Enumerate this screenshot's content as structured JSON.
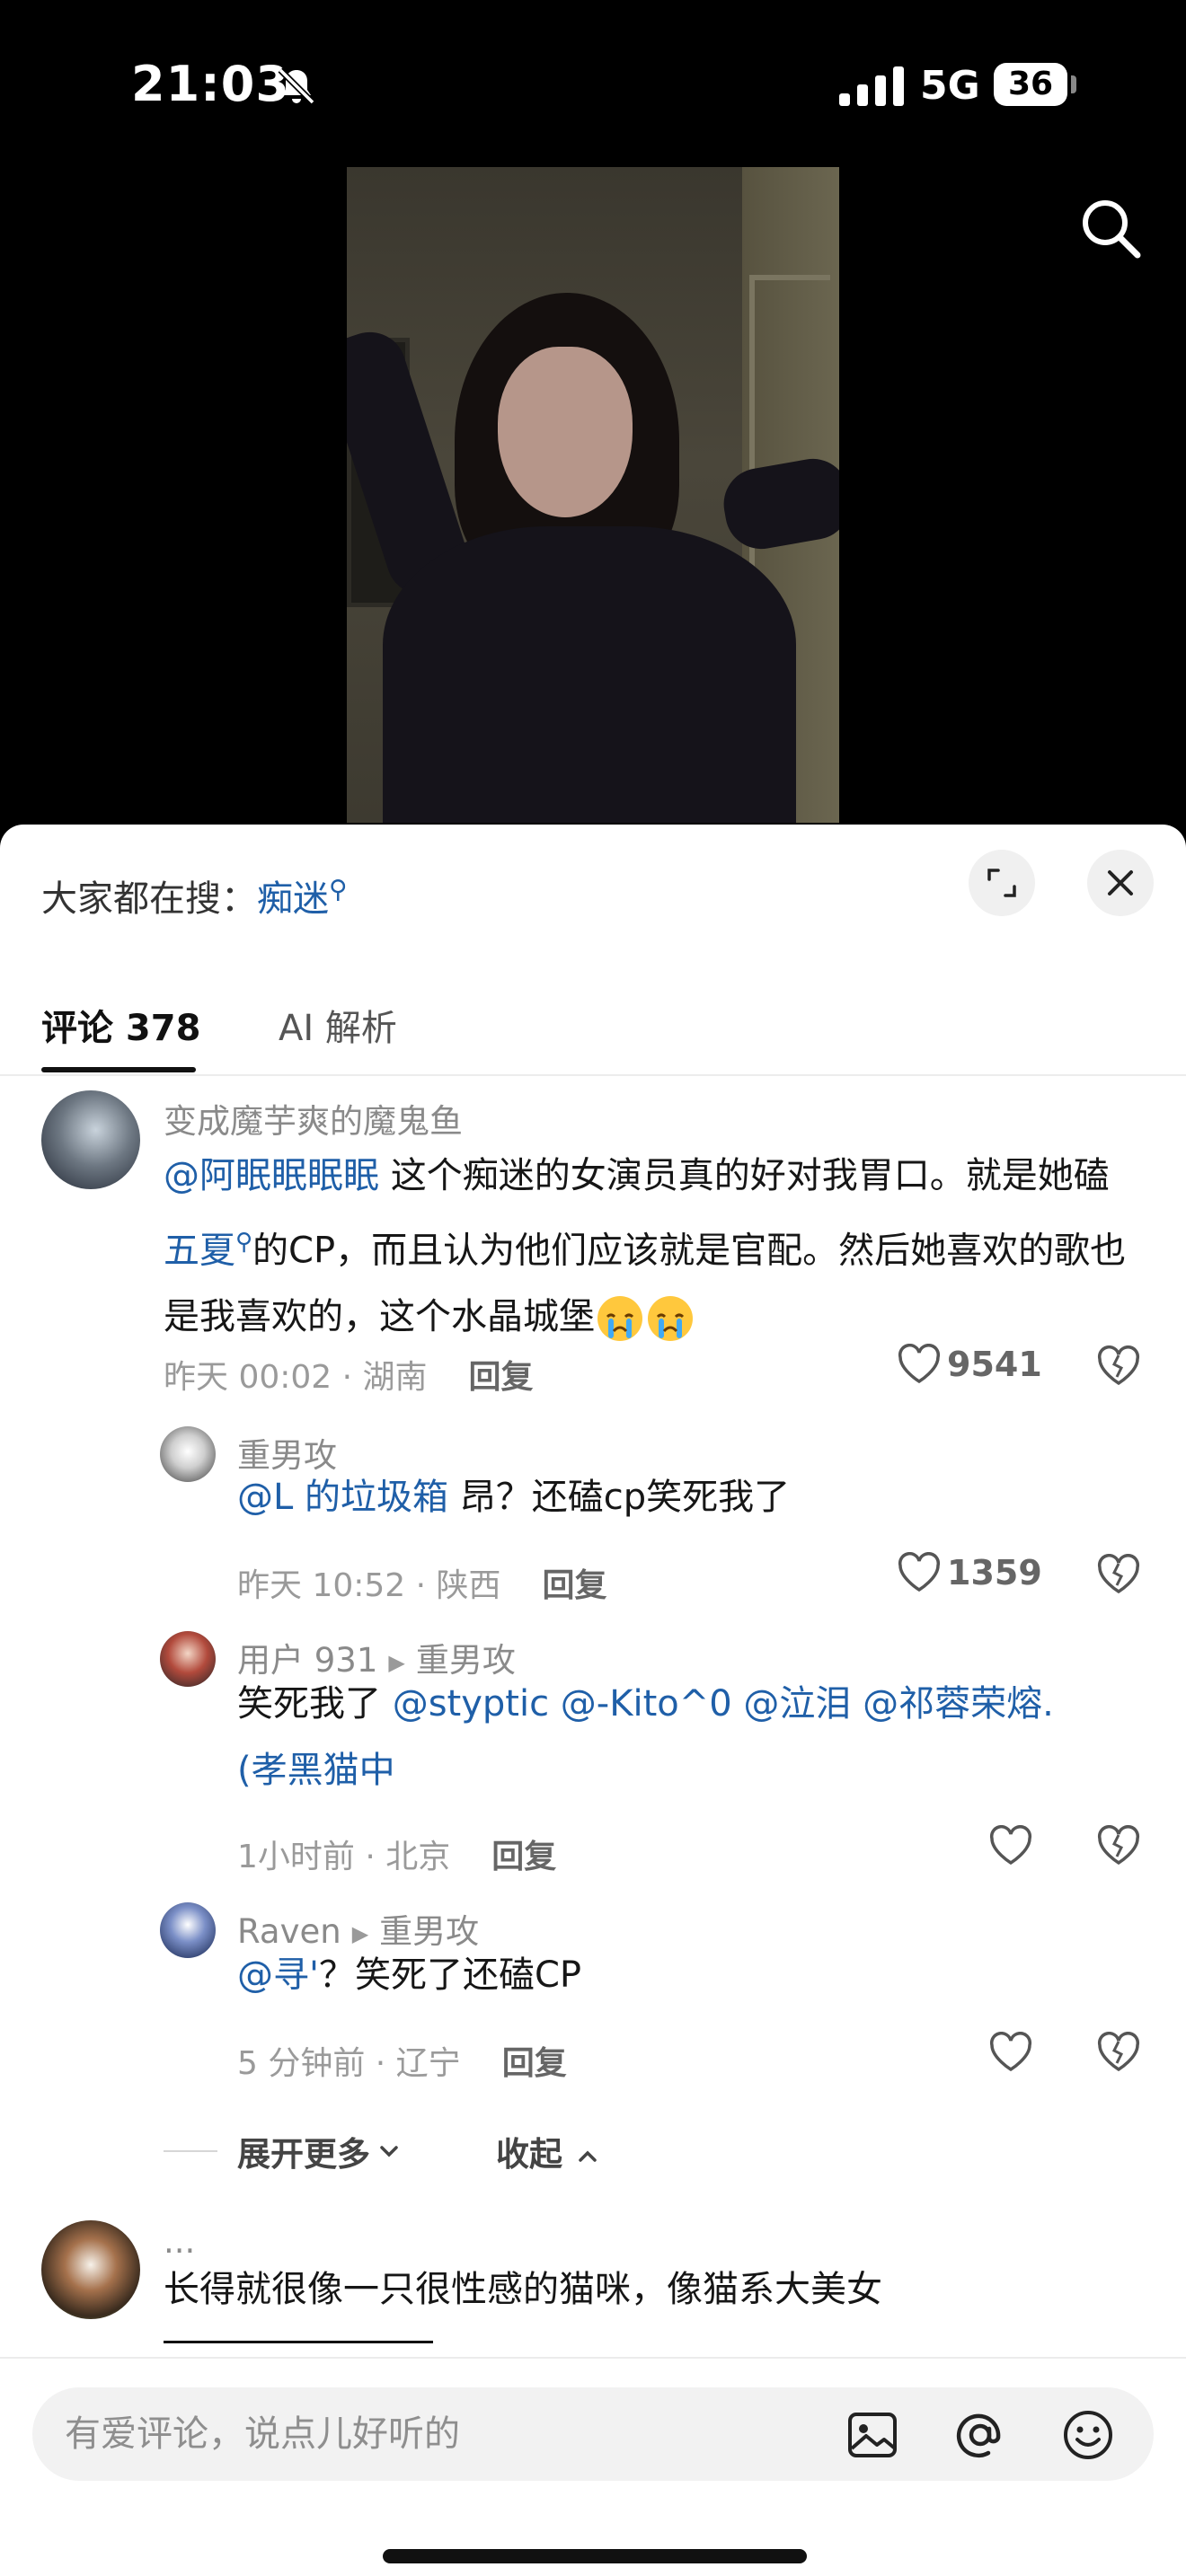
{
  "status_bar": {
    "time": "21:03",
    "network": "5G",
    "battery": "36"
  },
  "search_trend": {
    "prefix": "大家都在搜：",
    "keyword": "痴迷"
  },
  "tabs": [
    {
      "label": "评论 378"
    },
    {
      "label": "AI 解析"
    }
  ],
  "comments": [
    {
      "user": "变成魔芋爽的魔鬼鱼",
      "mention": "@阿眠眠眠眠",
      "text_a": " 这个痴迷的女演员真的好对我胃口。就是她磕",
      "link": "五夏",
      "text_b": "的CP，而且认为他们应该就是官配。然后她喜欢的歌也是我喜欢的，这个水晶城堡",
      "time_location": "昨天 00:02 · 湖南",
      "reply_label": "回复",
      "likes": "9541"
    },
    {
      "user": "重男攻",
      "mention": "@L 的垃圾箱",
      "text": " 昂？还磕cp笑死我了",
      "time_location": "昨天 10:52 · 陕西",
      "reply_label": "回复",
      "likes": "1359"
    },
    {
      "user": "用户 931",
      "reply_to": "重男攻",
      "text": "笑死我了 ",
      "mentions": "@styptic @-Kito^0 @泣泪 @祁蓉荣熔.",
      "mention_line2": "(孝黑猫中",
      "time_location": "1小时前 · 北京",
      "reply_label": "回复"
    },
    {
      "user": "Raven",
      "reply_to": "重男攻",
      "mention": "@寻'",
      "text": "？笑死了还磕CP",
      "time_location": "5 分钟前 · 辽宁",
      "reply_label": "回复"
    },
    {
      "user": "...",
      "text": "长得就很像一只很性感的猫咪，像猫系大美女"
    }
  ],
  "expand_label": "展开更多",
  "collapse_label": "收起",
  "input": {
    "placeholder": "有爱评论，说点儿好听的"
  },
  "icons": [
    "bell-slash-icon",
    "signal-icon",
    "search-icon",
    "expand-icon",
    "close-icon",
    "heart-icon",
    "dislike-icon",
    "image-icon",
    "at-icon",
    "emoji-icon"
  ],
  "colors": {
    "link": "#1f5fa8",
    "text": "#161616",
    "meta": "#9a9a9a",
    "background": "#ffffff"
  }
}
